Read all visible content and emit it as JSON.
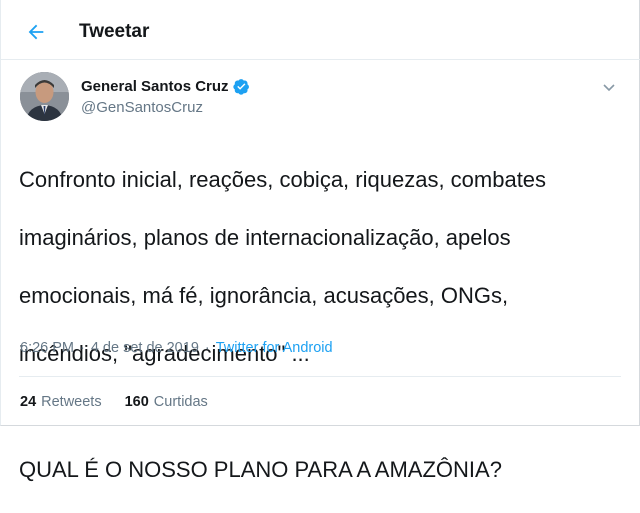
{
  "header": {
    "back_icon": "arrow-left-icon",
    "title": "Tweetar"
  },
  "author": {
    "display_name": "General Santos Cruz",
    "handle": "@GenSantosCruz",
    "verified": true,
    "avatar_icon": "avatar"
  },
  "tweet": {
    "lines": [
      "Confronto inicial, reações, cobiça, riquezas, combates",
      "imaginários, planos de internacionalização,  apelos",
      "emocionais, má fé, ignorância, acusações, ONGs,",
      "incêndios, \"agradecimento\" ...",
      "QUAL É O NOSSO PLANO PARA A AMAZÔNIA?"
    ],
    "time": "6:26 PM",
    "separator": "·",
    "date": "4 de set de 2019",
    "source": "Twitter for Android"
  },
  "stats": {
    "retweets_count": "24",
    "retweets_label": "Retweets",
    "likes_count": "160",
    "likes_label": "Curtidas"
  },
  "colors": {
    "accent": "#1da1f2",
    "muted": "#657786",
    "text": "#14171a",
    "border": "#e6ecf0"
  }
}
